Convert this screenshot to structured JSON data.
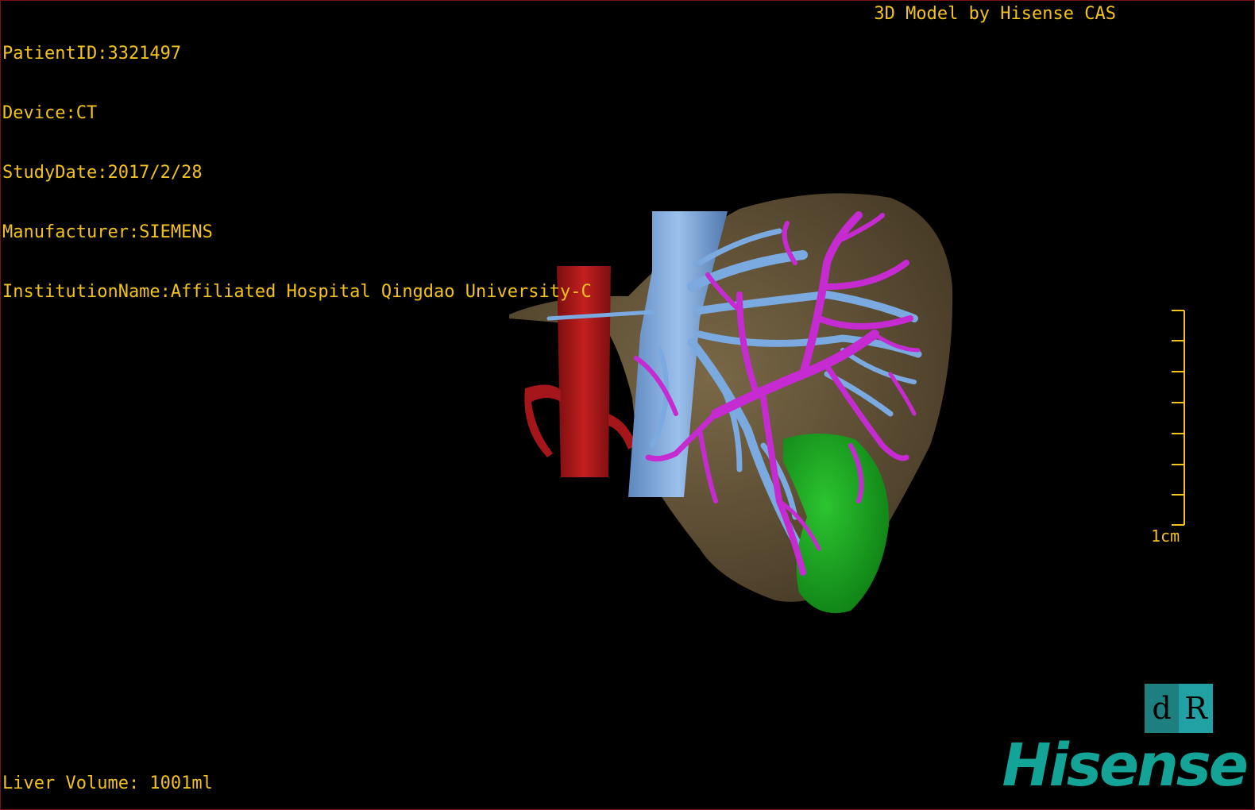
{
  "patient_info": {
    "patient_id": "PatientID:3321497",
    "device": "Device:CT",
    "study_date": "StudyDate:2017/2/28",
    "manufacturer": "Manufacturer:SIEMENS",
    "institution": "InstitutionName:Affiliated Hospital Qingdao University-C"
  },
  "model_credit": "3D Model by Hisense CAS",
  "liver_volume": "Liver Volume: 1001ml",
  "scale_bar": {
    "label": "1cm"
  },
  "orientation_cube": {
    "left_face": "d",
    "right_face": "R"
  },
  "brand": "Hisense",
  "colors": {
    "text": "#f3c21b",
    "liver": "#6b5a3c",
    "aorta": "#a5161a",
    "vena_cava": "#6f9fd8",
    "portal_vein": "#c52bd0",
    "tumor": "#1aaa22",
    "brand": "#14a397"
  }
}
